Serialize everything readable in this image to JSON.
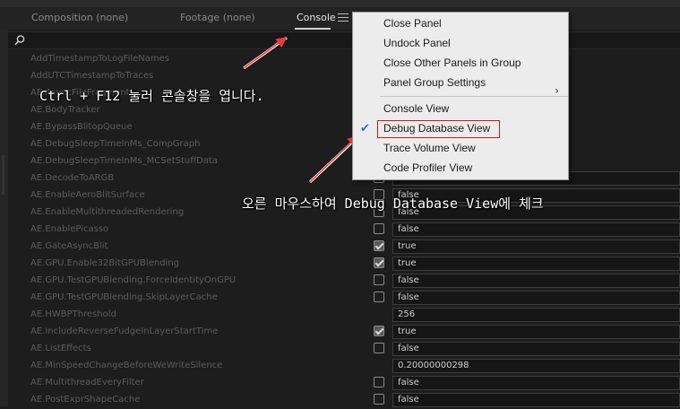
{
  "tabs": [
    {
      "label": "Composition (none)"
    },
    {
      "label": "Footage  (none)"
    },
    {
      "label": "Console"
    }
  ],
  "rows": [
    {
      "name": "AddTimestampToLogFileNames",
      "checked": null,
      "value": ""
    },
    {
      "name": "AddUTCTimestampToTraces",
      "checked": null,
      "value": ""
    },
    {
      "name": "AE.AsyncFileFragment",
      "checked": null,
      "value": ""
    },
    {
      "name": "AE.BodyTracker",
      "checked": null,
      "value": ""
    },
    {
      "name": "AE.BypassBlitopQueue",
      "checked": null,
      "value": ""
    },
    {
      "name": "AE.DebugSleepTimeInMs_CompGraph",
      "checked": null,
      "value": ""
    },
    {
      "name": "AE.DebugSleepTimeInMs_MCSetStuffData",
      "checked": null,
      "value": ""
    },
    {
      "name": "AE.DecodeToARGB",
      "checked": false,
      "value": "true"
    },
    {
      "name": "AE.EnableAeroBlitSurface",
      "checked": false,
      "value": "false"
    },
    {
      "name": "AE.EnableMultithreadedRendering",
      "checked": false,
      "value": "false"
    },
    {
      "name": "AE.EnablePicasso",
      "checked": false,
      "value": "false"
    },
    {
      "name": "AE.GateAsyncBlit",
      "checked": true,
      "value": "true"
    },
    {
      "name": "AE.GPU.Enable32BitGPUBlending",
      "checked": true,
      "value": "true"
    },
    {
      "name": "AE.GPU.TestGPUBlending.ForceIdentityOnGPU",
      "checked": false,
      "value": "false"
    },
    {
      "name": "AE.GPU.TestGPUBlending.SkipLayerCache",
      "checked": false,
      "value": "false"
    },
    {
      "name": "AE.HWBPThreshold",
      "checked": null,
      "value": "256"
    },
    {
      "name": "AE.IncludeReverseFudgeInLayerStartTime",
      "checked": true,
      "value": "true"
    },
    {
      "name": "AE.ListEffects",
      "checked": false,
      "value": "false"
    },
    {
      "name": "AE.MinSpeedChangeBeforeWeWriteSilence",
      "checked": null,
      "value": "0.20000000298"
    },
    {
      "name": "AE.MultithreadEveryFilter",
      "checked": false,
      "value": "false"
    },
    {
      "name": "AE.PostExprShapeCache",
      "checked": false,
      "value": "false"
    }
  ],
  "menu": {
    "items": [
      {
        "label": "Close Panel"
      },
      {
        "label": "Undock Panel"
      },
      {
        "label": "Close Other Panels in Group"
      },
      {
        "label": "Panel Group Settings",
        "submenu": true
      },
      {
        "label": "Console View"
      },
      {
        "label": "Debug Database View",
        "checked": true
      },
      {
        "label": "Trace Volume View"
      },
      {
        "label": "Code Profiler View"
      }
    ],
    "submenu_arrow": "›",
    "check_glyph": "✔"
  },
  "annotations": {
    "ann1": "Ctrl + F12 눌러 콘솔창을 엽니다.",
    "ann2": "오른 마우스하여 Debug Database View에 체크"
  },
  "colors": {
    "annotation_arrow": "#e83a3a",
    "highlight_box": "#dd1111",
    "check": "#2f6fc8"
  }
}
